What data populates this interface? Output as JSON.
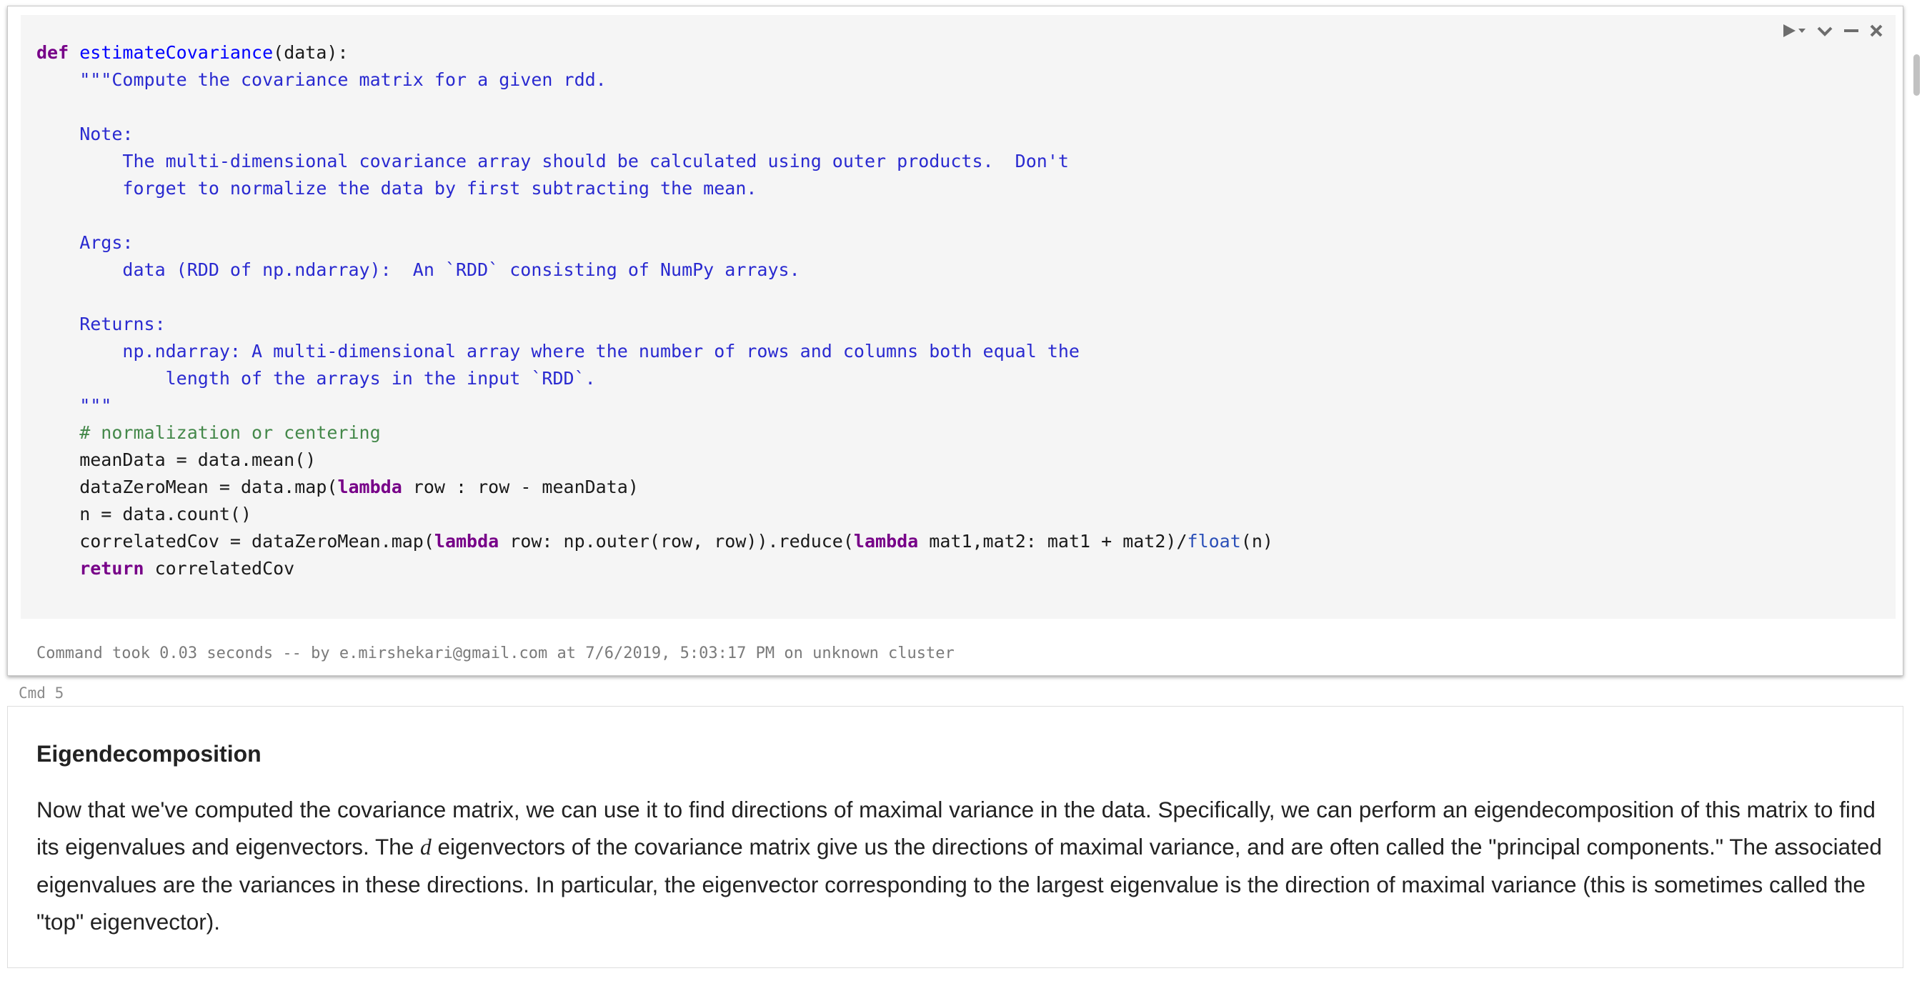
{
  "code_cell": {
    "toolbar": {
      "run_icon": "run-dropdown-icon",
      "collapse_icon": "chevron-down-icon",
      "minimize_icon": "minimize-icon",
      "close_icon": "close-icon"
    },
    "lines": [
      [
        {
          "t": "kw",
          "v": "def"
        },
        {
          "t": "p",
          "v": " "
        },
        {
          "t": "fn",
          "v": "estimateCovariance"
        },
        {
          "t": "p",
          "v": "(data):"
        }
      ],
      [
        {
          "t": "doc",
          "v": "    \"\"\"Compute the covariance matrix for a given rdd."
        }
      ],
      [
        {
          "t": "p",
          "v": ""
        }
      ],
      [
        {
          "t": "doc",
          "v": "    Note:"
        }
      ],
      [
        {
          "t": "doc",
          "v": "        The multi-dimensional covariance array should be calculated using outer products.  Don't"
        }
      ],
      [
        {
          "t": "doc",
          "v": "        forget to normalize the data by first subtracting the mean."
        }
      ],
      [
        {
          "t": "p",
          "v": ""
        }
      ],
      [
        {
          "t": "doc",
          "v": "    Args:"
        }
      ],
      [
        {
          "t": "doc",
          "v": "        data (RDD of np.ndarray):  An `RDD` consisting of NumPy arrays."
        }
      ],
      [
        {
          "t": "p",
          "v": ""
        }
      ],
      [
        {
          "t": "doc",
          "v": "    Returns:"
        }
      ],
      [
        {
          "t": "doc",
          "v": "        np.ndarray: A multi-dimensional array where the number of rows and columns both equal the"
        }
      ],
      [
        {
          "t": "doc",
          "v": "            length of the arrays in the input `RDD`."
        }
      ],
      [
        {
          "t": "doc",
          "v": "    \"\"\""
        }
      ],
      [
        {
          "t": "cm",
          "v": "    # normalization or centering"
        }
      ],
      [
        {
          "t": "p",
          "v": "    meanData = data.mean()"
        }
      ],
      [
        {
          "t": "p",
          "v": "    dataZeroMean = data.map("
        },
        {
          "t": "kw",
          "v": "lambda"
        },
        {
          "t": "p",
          "v": " row : row - meanData)"
        }
      ],
      [
        {
          "t": "p",
          "v": "    n = data.count()"
        }
      ],
      [
        {
          "t": "p",
          "v": "    correlatedCov = dataZeroMean.map("
        },
        {
          "t": "kw",
          "v": "lambda"
        },
        {
          "t": "p",
          "v": " row: np.outer(row, row)).reduce("
        },
        {
          "t": "kw",
          "v": "lambda"
        },
        {
          "t": "p",
          "v": " mat1,mat2: mat1 + mat2)/"
        },
        {
          "t": "bi",
          "v": "float"
        },
        {
          "t": "p",
          "v": "(n)"
        }
      ],
      [
        {
          "t": "kw",
          "v": "    return"
        },
        {
          "t": "p",
          "v": " correlatedCov"
        }
      ]
    ],
    "footer": "Command took 0.03 seconds -- by e.mirshekari@gmail.com at 7/6/2019, 5:03:17 PM on unknown cluster"
  },
  "cmd_label": "Cmd 5",
  "markdown_cell": {
    "heading": "Eigendecomposition",
    "para_before_math": "Now that we've computed the covariance matrix, we can use it to find directions of maximal variance in the data. Specifically, we can perform an eigendecomposition of this matrix to find its eigenvalues and eigenvectors. The ",
    "math_symbol": "d",
    "para_after_math": " eigenvectors of the covariance matrix give us the directions of maximal variance, and are often called the \"principal components.\" The associated eigenvalues are the variances in these directions. In particular, the eigenvector corresponding to the largest eigenvalue is the direction of maximal variance (this is sometimes called the \"top\" eigenvector)."
  },
  "colors": {
    "keyword": "#770088",
    "function_name": "#0000ff",
    "docstring": "#2a2ad0",
    "comment": "#44884a",
    "builtin": "#2a4fb8",
    "code_background": "#f5f5f5"
  }
}
